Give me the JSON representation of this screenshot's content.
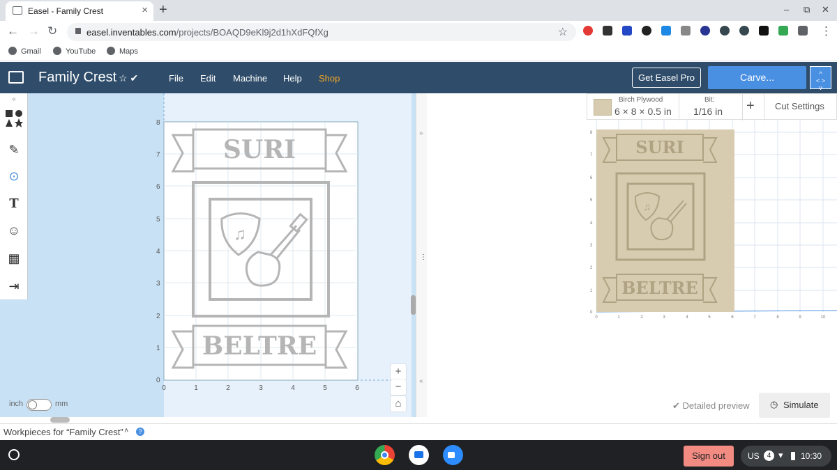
{
  "browser": {
    "tab_title": "Easel - Family Crest",
    "tab_close": "×",
    "new_tab": "+",
    "url_domain": "easel.inventables.com",
    "url_path": "/projects/BOAQD9eKl9j2d1hXdFQfXg",
    "bookmarks": [
      "Gmail",
      "YouTube",
      "Maps"
    ],
    "window_controls": [
      "–",
      "⧉",
      "✕"
    ]
  },
  "app": {
    "project_title": "Family Crest",
    "menu": [
      "File",
      "Edit",
      "Machine",
      "Help",
      "Shop"
    ],
    "get_pro_label": "Get Easel Pro",
    "carve_label": "Carve...",
    "expand_icon": "expand-arrows-icon"
  },
  "canvas": {
    "y_ticks": [
      "8",
      "7",
      "6",
      "5",
      "4",
      "3",
      "2",
      "1",
      "0"
    ],
    "x_ticks": [
      "0",
      "1",
      "2",
      "3",
      "4",
      "5",
      "6"
    ],
    "top_banner_text": "SURI",
    "bottom_banner_text": "BELTRE",
    "unit_left": "inch",
    "unit_right": "mm",
    "zoom_in": "+",
    "zoom_out": "−"
  },
  "material": {
    "name": "Birch Plywood",
    "size": "6 × 8 × 0.5 in",
    "bit_label": "Bit:",
    "bit_value": "1/16 in",
    "add": "+",
    "cut_settings": "Cut Settings",
    "swatch_color": "#d8ccb0"
  },
  "preview": {
    "y_ticks": [
      "8",
      "7",
      "6",
      "5",
      "4",
      "3",
      "2",
      "1",
      "0"
    ],
    "x_ticks": [
      "0",
      "1",
      "2",
      "3",
      "4",
      "5",
      "6",
      "7",
      "8",
      "9",
      "10"
    ],
    "top_text": "SURI",
    "bottom_text": "BELTRE",
    "detailed_preview_label": "Detailed preview",
    "simulate_label": "Simulate"
  },
  "footer": {
    "workpieces_label": "Workpieces for “Family Crest”"
  },
  "shelf": {
    "sign_out_label": "Sign out",
    "locale": "US",
    "notifications": "4",
    "time": "10:30"
  },
  "colors": {
    "header_bg": "#2f4d6a",
    "carve_bg": "#4a90e2",
    "shop_color": "#f5a623",
    "sign_out_bg": "#f28b82",
    "design_stroke": "#b5b5b5",
    "wood": "#d8ccb0"
  }
}
